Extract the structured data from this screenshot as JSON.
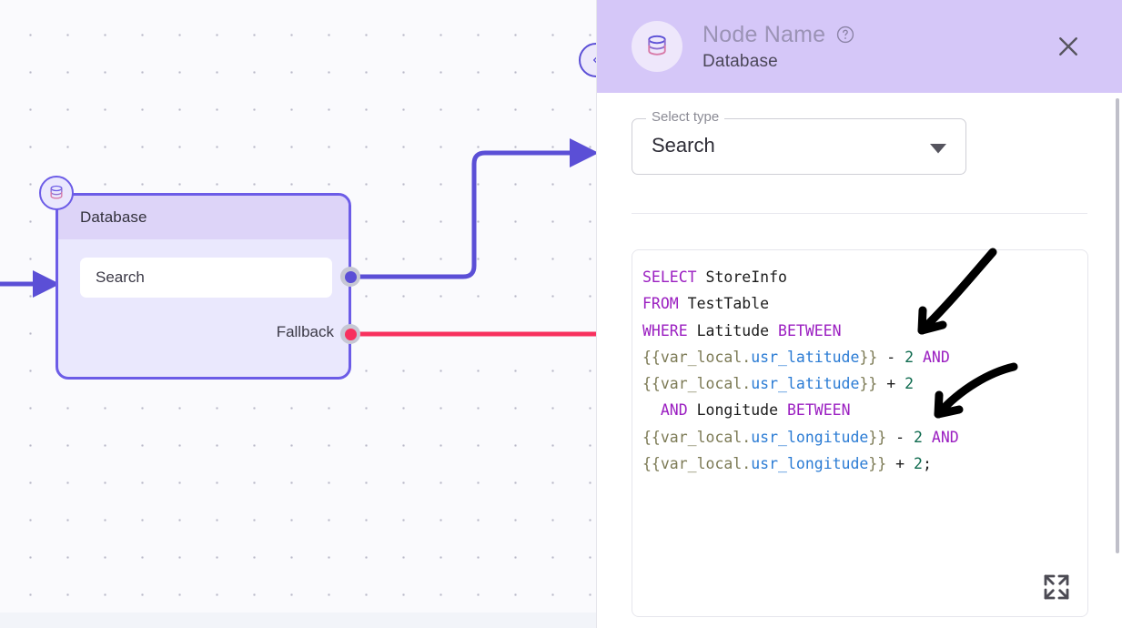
{
  "canvas": {
    "node": {
      "title": "Database",
      "search_field_value": "Search",
      "fallback_label": "Fallback",
      "icon": "database-icon",
      "border_color": "#6c5ce7",
      "header_bg": "#ddd4f8",
      "body_bg": "#eae8fd"
    },
    "ports": {
      "output_main_color": "#5b4fd6",
      "output_fallback_color": "#f8315e"
    },
    "edges": {
      "main_color": "#5b4fd6",
      "fallback_color": "#f8315e"
    },
    "collapse_button": {
      "icon": "chevron-left-icon"
    }
  },
  "panel": {
    "header": {
      "node_name": "Node Name",
      "subtitle": "Database",
      "help_icon": "question-mark-circle-icon",
      "close_icon": "close-icon",
      "icon": "database-icon",
      "bg": "#d5c7f8"
    },
    "select_type": {
      "legend": "Select type",
      "value": "Search",
      "arrow_icon": "chevron-down-icon"
    },
    "code": {
      "expand_icon": "expand-fullscreen-icon",
      "lines": [
        [
          {
            "t": "SELECT",
            "c": "kw"
          },
          {
            "t": " StoreInfo",
            "c": "plain"
          }
        ],
        [
          {
            "t": "FROM",
            "c": "kw"
          },
          {
            "t": " TestTable",
            "c": "plain"
          }
        ],
        [
          {
            "t": "WHERE",
            "c": "kw"
          },
          {
            "t": " Latitude ",
            "c": "plain"
          },
          {
            "t": "BETWEEN",
            "c": "kw"
          }
        ],
        [
          {
            "t": "{{var_local.",
            "c": "var"
          },
          {
            "t": "usr_latitude",
            "c": "prop"
          },
          {
            "t": "}}",
            "c": "var"
          },
          {
            "t": " - ",
            "c": "op"
          },
          {
            "t": "2",
            "c": "num"
          },
          {
            "t": " ",
            "c": "plain"
          },
          {
            "t": "AND",
            "c": "kw"
          }
        ],
        [
          {
            "t": "{{var_local.",
            "c": "var"
          },
          {
            "t": "usr_latitude",
            "c": "prop"
          },
          {
            "t": "}}",
            "c": "var"
          },
          {
            "t": " + ",
            "c": "op"
          },
          {
            "t": "2",
            "c": "num"
          }
        ],
        [
          {
            "t": "  ",
            "c": "plain"
          },
          {
            "t": "AND",
            "c": "kw"
          },
          {
            "t": " Longitude ",
            "c": "plain"
          },
          {
            "t": "BETWEEN",
            "c": "kw"
          }
        ],
        [
          {
            "t": "{{var_local.",
            "c": "var"
          },
          {
            "t": "usr_longitude",
            "c": "prop"
          },
          {
            "t": "}}",
            "c": "var"
          },
          {
            "t": " - ",
            "c": "op"
          },
          {
            "t": "2",
            "c": "num"
          },
          {
            "t": " ",
            "c": "plain"
          },
          {
            "t": "AND",
            "c": "kw"
          }
        ],
        [
          {
            "t": "{{var_local.",
            "c": "var"
          },
          {
            "t": "usr_longitude",
            "c": "prop"
          },
          {
            "t": "}}",
            "c": "var"
          },
          {
            "t": " + ",
            "c": "op"
          },
          {
            "t": "2",
            "c": "num"
          },
          {
            "t": ";",
            "c": "plain"
          }
        ]
      ]
    },
    "annotations": [
      {
        "name": "hand-drawn-arrow-1"
      },
      {
        "name": "hand-drawn-arrow-2"
      }
    ]
  }
}
